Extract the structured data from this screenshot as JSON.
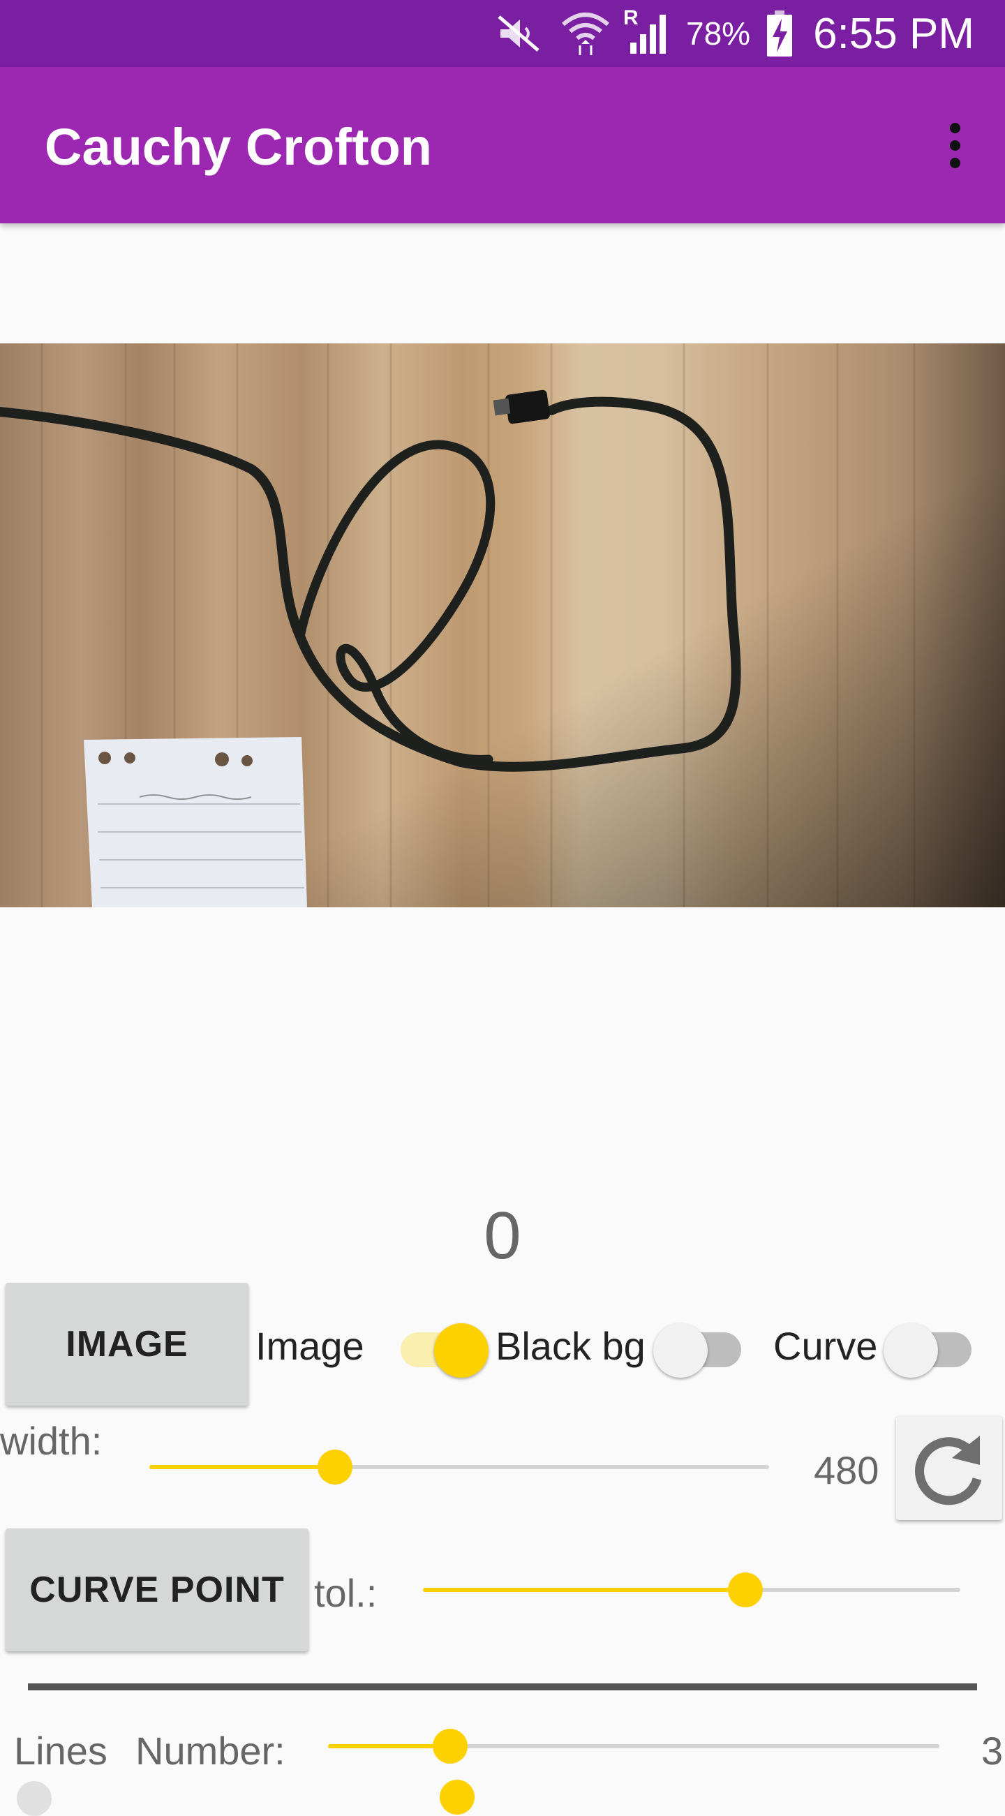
{
  "status_bar": {
    "battery": "78%",
    "time": "6:55 PM",
    "roaming_indicator": "R",
    "icons": [
      "mute-icon",
      "wifi-icon",
      "signal-icon",
      "battery-charging-icon"
    ]
  },
  "app_bar": {
    "title": "Cauchy Crofton",
    "menu_icon": "overflow-menu-icon"
  },
  "result": {
    "value": "0"
  },
  "controls": {
    "image_button": "IMAGE",
    "image_switch_label": "Image",
    "image_switch_on": true,
    "black_bg_label": "Black bg",
    "black_bg_on": false,
    "curve_label": "Curve",
    "curve_on": false,
    "width_label": "width:",
    "width_value": "480",
    "width_slider_fraction": 0.3,
    "refresh_icon": "refresh-icon",
    "curve_point_button": "CURVE POINT",
    "tol_label": "tol.:",
    "tol_slider_fraction": 0.6,
    "lines_label": "Lines",
    "number_label": "Number:",
    "number_value": "3",
    "number_slider_fraction": 0.2
  },
  "colors": {
    "status_bar": "#7B1FA2",
    "app_bar": "#9C27B0",
    "accent": "#FDD000"
  }
}
